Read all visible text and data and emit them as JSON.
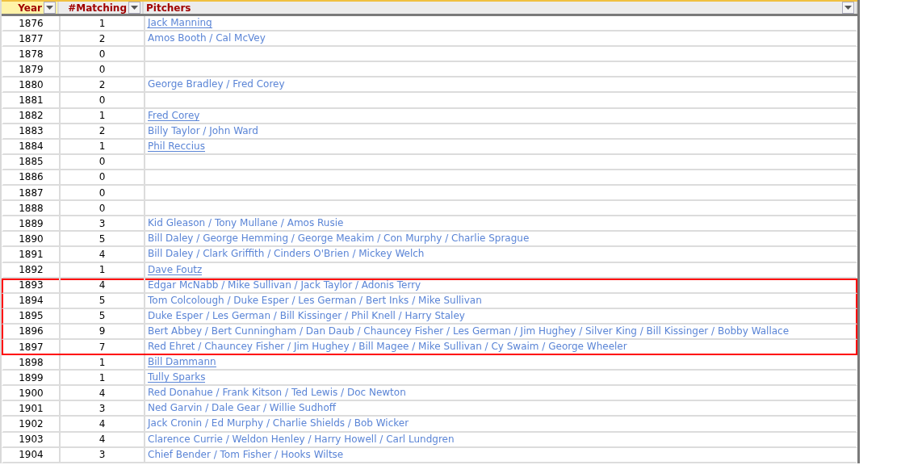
{
  "columns": [
    {
      "label": "Year",
      "filter": true,
      "selected": true
    },
    {
      "label": "#Matching",
      "filter": true,
      "selected": false
    },
    {
      "label": "Pitchers",
      "filter": true,
      "selected": false
    }
  ],
  "rows": [
    {
      "year": "1876",
      "matching": "1",
      "pitchers": "Jack Manning",
      "linked": true,
      "highlighted": false
    },
    {
      "year": "1877",
      "matching": "2",
      "pitchers": "Amos Booth / Cal McVey",
      "linked": false,
      "highlighted": false
    },
    {
      "year": "1878",
      "matching": "0",
      "highlighted": false
    },
    {
      "year": "1879",
      "matching": "0",
      "highlighted": false
    },
    {
      "year": "1880",
      "matching": "2",
      "pitchers": "George Bradley / Fred Corey",
      "linked": false,
      "highlighted": false
    },
    {
      "year": "1881",
      "matching": "0",
      "highlighted": false
    },
    {
      "year": "1882",
      "matching": "1",
      "pitchers": "Fred Corey",
      "linked": true,
      "highlighted": false
    },
    {
      "year": "1883",
      "matching": "2",
      "pitchers": "Billy Taylor / John Ward",
      "linked": false,
      "highlighted": false
    },
    {
      "year": "1884",
      "matching": "1",
      "pitchers": "Phil Reccius",
      "linked": true,
      "highlighted": false
    },
    {
      "year": "1885",
      "matching": "0",
      "highlighted": false
    },
    {
      "year": "1886",
      "matching": "0",
      "highlighted": false
    },
    {
      "year": "1887",
      "matching": "0",
      "highlighted": false
    },
    {
      "year": "1888",
      "matching": "0",
      "highlighted": false
    },
    {
      "year": "1889",
      "matching": "3",
      "pitchers": "Kid Gleason / Tony Mullane / Amos Rusie",
      "linked": false,
      "highlighted": false
    },
    {
      "year": "1890",
      "matching": "5",
      "pitchers": "Bill Daley / George Hemming / George Meakim / Con Murphy / Charlie Sprague",
      "linked": false,
      "highlighted": false
    },
    {
      "year": "1891",
      "matching": "4",
      "pitchers": "Bill Daley / Clark Griffith / Cinders O'Brien / Mickey Welch",
      "linked": false,
      "highlighted": false
    },
    {
      "year": "1892",
      "matching": "1",
      "pitchers": "Dave Foutz",
      "linked": true,
      "highlighted": false
    },
    {
      "year": "1893",
      "matching": "4",
      "pitchers": "Edgar McNabb / Mike Sullivan / Jack Taylor / Adonis Terry",
      "linked": false,
      "highlighted": true
    },
    {
      "year": "1894",
      "matching": "5",
      "pitchers": "Tom Colcolough / Duke Esper / Les German / Bert Inks / Mike Sullivan",
      "linked": false,
      "highlighted": true
    },
    {
      "year": "1895",
      "matching": "5",
      "pitchers": "Duke Esper / Les German / Bill Kissinger / Phil Knell / Harry Staley",
      "linked": false,
      "highlighted": true
    },
    {
      "year": "1896",
      "matching": "9",
      "pitchers": "Bert Abbey / Bert Cunningham / Dan Daub / Chauncey Fisher / Les German / Jim Hughey / Silver King / Bill Kissinger / Bobby Wallace",
      "linked": false,
      "highlighted": true
    },
    {
      "year": "1897",
      "matching": "7",
      "pitchers": "Red Ehret / Chauncey Fisher / Jim Hughey / Bill Magee / Mike Sullivan / Cy Swaim / George Wheeler",
      "linked": false,
      "highlighted": true
    },
    {
      "year": "1898",
      "matching": "1",
      "pitchers": "Bill Dammann",
      "linked": true,
      "highlighted": false
    },
    {
      "year": "1899",
      "matching": "1",
      "pitchers": "Tully Sparks",
      "linked": true,
      "highlighted": false
    },
    {
      "year": "1900",
      "matching": "4",
      "pitchers": "Red Donahue / Frank Kitson / Ted Lewis / Doc Newton",
      "linked": false,
      "highlighted": false
    },
    {
      "year": "1901",
      "matching": "3",
      "pitchers": "Ned Garvin / Dale Gear / Willie Sudhoff",
      "linked": false,
      "highlighted": false
    },
    {
      "year": "1902",
      "matching": "4",
      "pitchers": "Jack Cronin / Ed Murphy / Charlie Shields / Bob Wicker",
      "linked": false,
      "highlighted": false
    },
    {
      "year": "1903",
      "matching": "4",
      "pitchers": "Clarence Currie / Weldon Henley / Harry Howell / Carl Lundgren",
      "linked": false,
      "highlighted": false
    },
    {
      "year": "1904",
      "matching": "3",
      "pitchers": "Chief Bender / Tom Fisher / Hooks Wiltse",
      "linked": false,
      "highlighted": false
    }
  ]
}
